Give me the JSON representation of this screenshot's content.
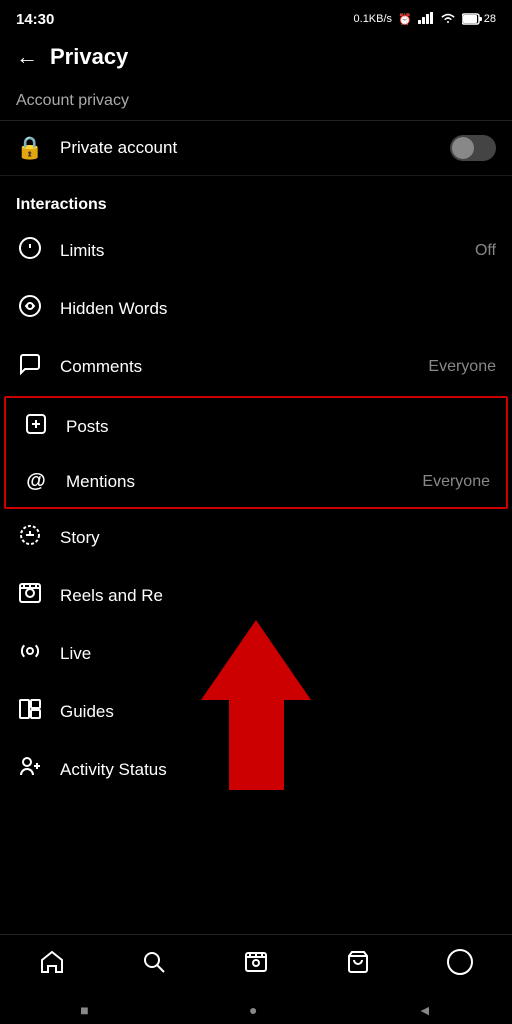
{
  "statusBar": {
    "time": "14:30",
    "network": "0.1KB/s",
    "battery": "28"
  },
  "header": {
    "backLabel": "←",
    "title": "Privacy"
  },
  "partialItem": {
    "label": "Account privacy"
  },
  "privateAccount": {
    "label": "Private account",
    "iconSymbol": "🔒"
  },
  "sections": {
    "interactions": {
      "label": "Interactions",
      "items": [
        {
          "id": "limits",
          "icon": "⊙",
          "label": "Limits",
          "value": "Off"
        },
        {
          "id": "hidden-words",
          "icon": "◑",
          "label": "Hidden Words",
          "value": ""
        },
        {
          "id": "comments",
          "icon": "◯",
          "label": "Comments",
          "value": "Everyone"
        },
        {
          "id": "posts",
          "icon": "⊕",
          "label": "Posts",
          "value": ""
        },
        {
          "id": "mentions",
          "icon": "@",
          "label": "Mentions",
          "value": "Everyone"
        },
        {
          "id": "story",
          "icon": "⊕",
          "label": "Story",
          "value": ""
        },
        {
          "id": "reels",
          "icon": "▷",
          "label": "Reels and Re",
          "value": ""
        },
        {
          "id": "live",
          "icon": "◉",
          "label": "Live",
          "value": ""
        },
        {
          "id": "guides",
          "icon": "⊞",
          "label": "Guides",
          "value": ""
        },
        {
          "id": "activity-status",
          "icon": "👤",
          "label": "Activity Status",
          "value": ""
        }
      ]
    }
  },
  "bottomNav": {
    "items": [
      {
        "id": "home",
        "icon": "⌂",
        "label": "home"
      },
      {
        "id": "search",
        "icon": "⌕",
        "label": "search"
      },
      {
        "id": "reels",
        "icon": "▷",
        "label": "reels"
      },
      {
        "id": "shop",
        "icon": "🛍",
        "label": "shop"
      },
      {
        "id": "profile",
        "icon": "◯",
        "label": "profile"
      }
    ]
  },
  "androidNav": {
    "square": "■",
    "circle": "●",
    "triangle": "◄"
  }
}
